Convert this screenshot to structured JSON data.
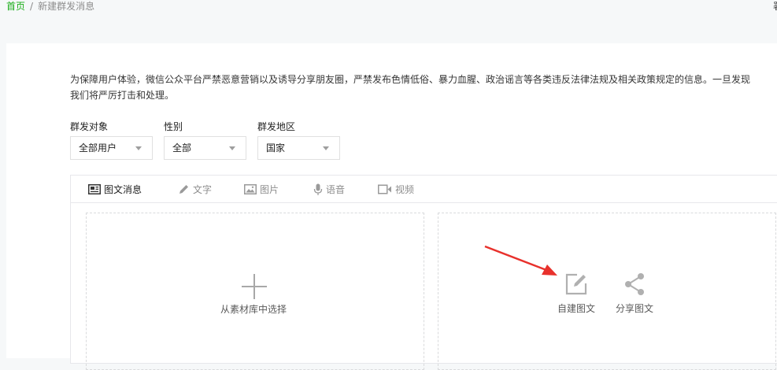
{
  "breadcrumb": {
    "home": "首页",
    "separator": "/",
    "current": "新建群发消息"
  },
  "top_right_char": "署",
  "notice": {
    "line1": "为保障用户体验，微信公众平台严禁恶意营销以及诱导分享朋友圈，严禁发布色情低俗、暴力血腥、政治谣言等各类违反法律法规及相关政策规定的信息。一旦发现",
    "line2": "我们将严厉打击和处理。"
  },
  "filters": [
    {
      "label": "群发对象",
      "value": "全部用户"
    },
    {
      "label": "性别",
      "value": "全部"
    },
    {
      "label": "群发地区",
      "value": "国家"
    }
  ],
  "tabs": [
    {
      "label": "图文消息",
      "icon": "news-icon",
      "active": true
    },
    {
      "label": "文字",
      "icon": "pencil-icon"
    },
    {
      "label": "图片",
      "icon": "image-icon"
    },
    {
      "label": "语音",
      "icon": "microphone-icon"
    },
    {
      "label": "视频",
      "icon": "video-icon"
    }
  ],
  "left_pane": {
    "label": "从素材库中选择",
    "icon": "plus-icon"
  },
  "right_pane": {
    "actions": [
      {
        "label": "自建图文",
        "icon": "edit-icon"
      },
      {
        "label": "分享图文",
        "icon": "share-icon"
      }
    ]
  },
  "colors": {
    "accent": "#1aad19",
    "annotation_arrow": "#e8312c",
    "border": "#e7e7eb"
  }
}
